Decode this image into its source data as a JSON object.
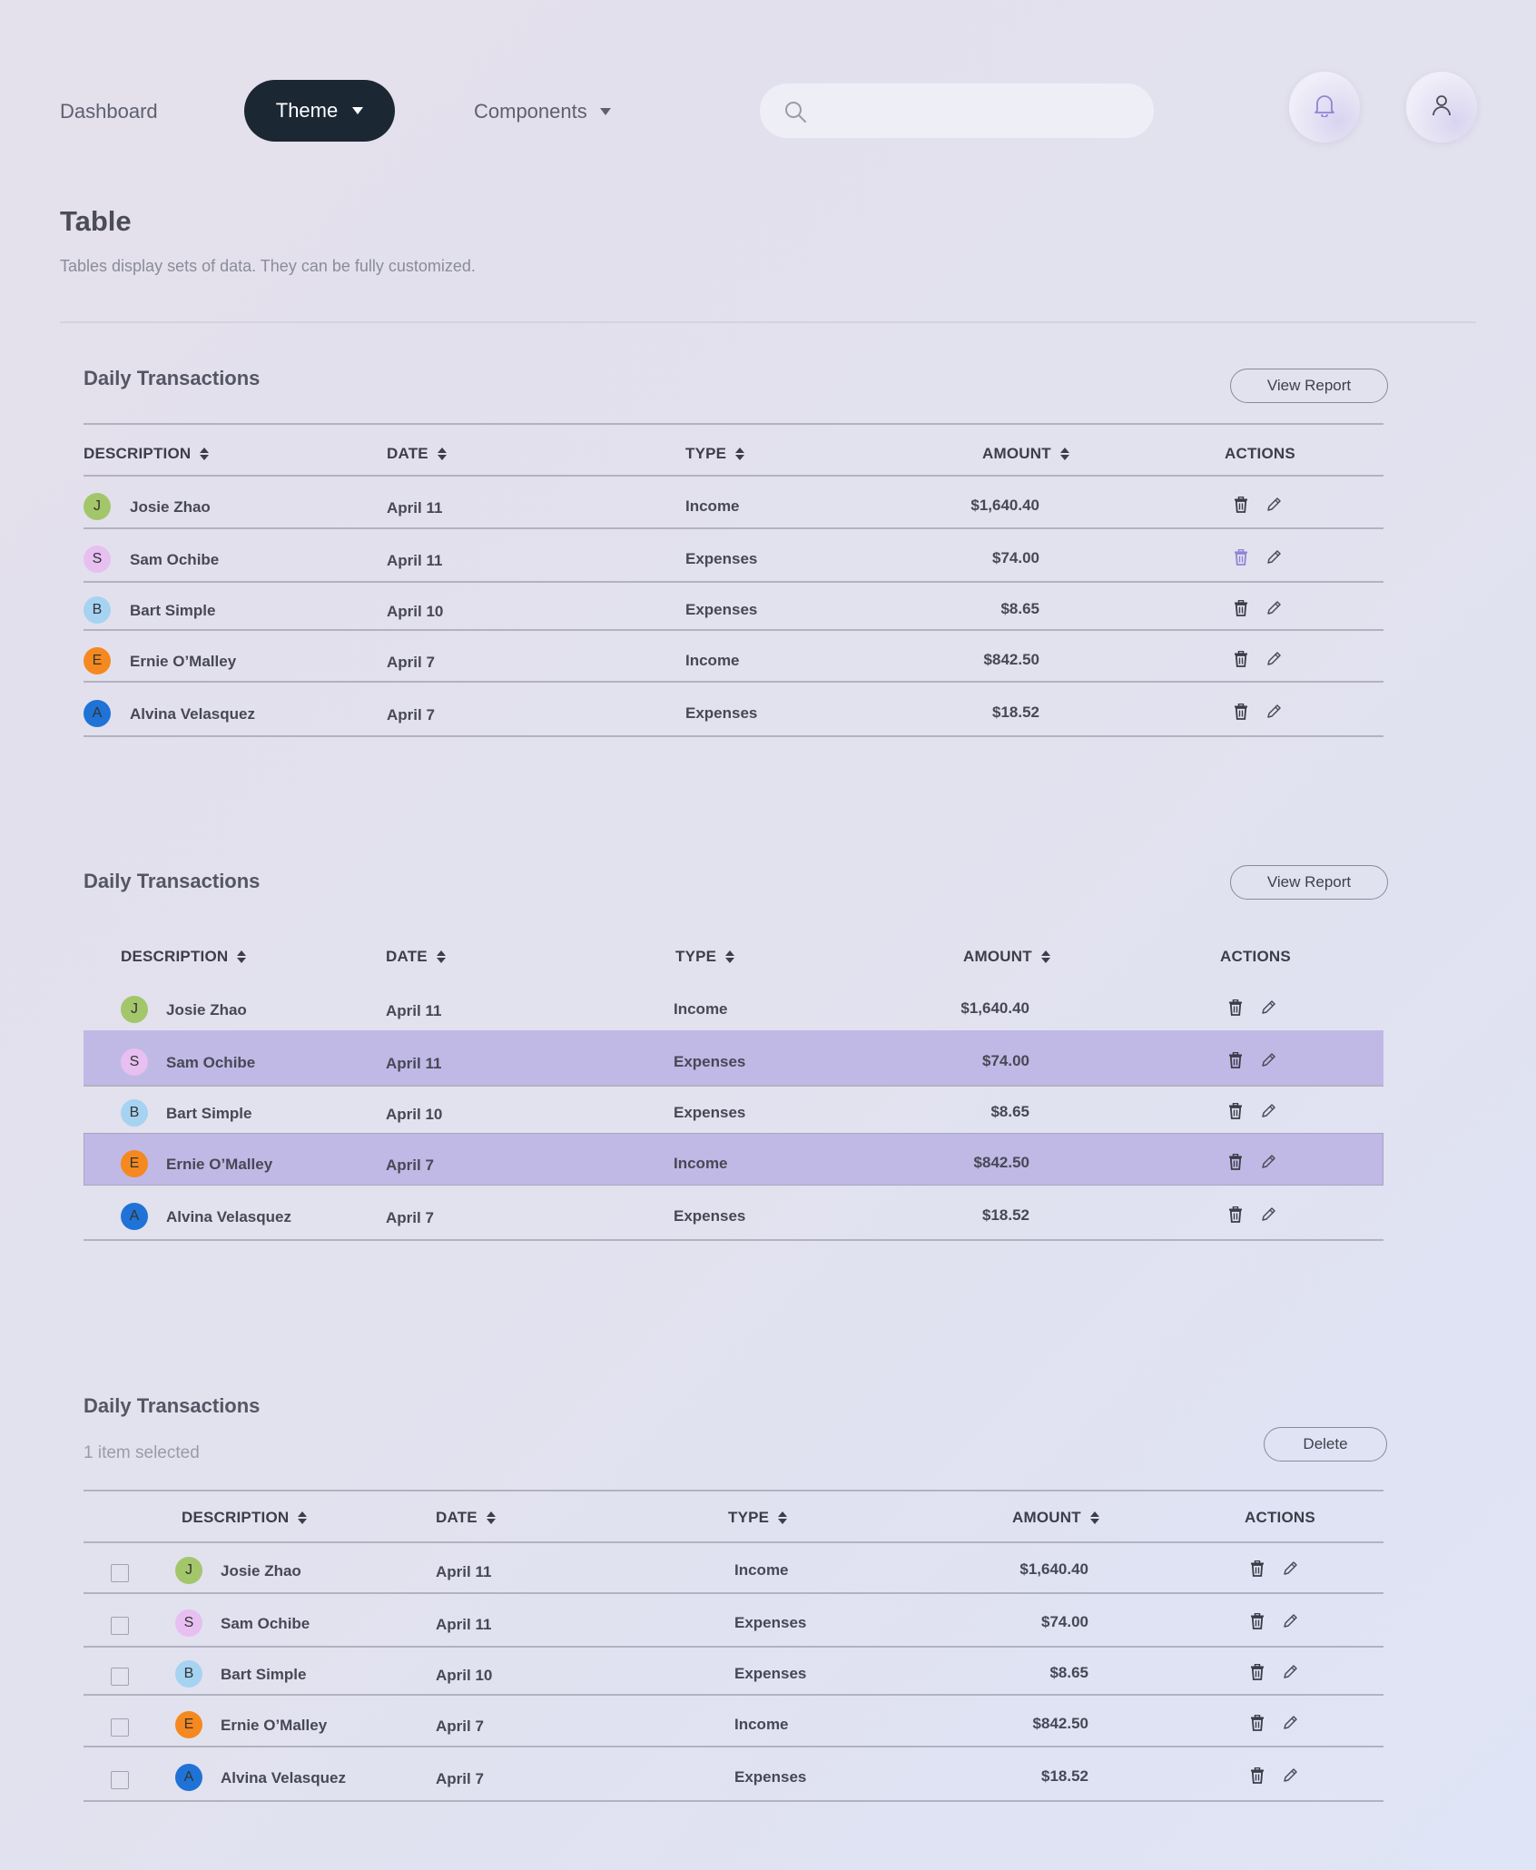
{
  "nav": {
    "dashboard": "Dashboard",
    "theme": "Theme",
    "components": "Components",
    "search_placeholder": ""
  },
  "page": {
    "title": "Table",
    "subtitle": "Tables display sets of data. They can be fully customized."
  },
  "tables": [
    {
      "title": "Daily Transactions",
      "button": "View Report",
      "columns": [
        "DESCRIPTION",
        "DATE",
        "TYPE",
        "AMOUNT",
        "ACTIONS"
      ]
    },
    {
      "title": "Daily Transactions",
      "button": "View Report",
      "columns": [
        "DESCRIPTION",
        "DATE",
        "TYPE",
        "AMOUNT",
        "ACTIONS"
      ]
    },
    {
      "title": "Daily Transactions",
      "selected_text": "1 item selected",
      "button": "Delete",
      "columns": [
        "DESCRIPTION",
        "DATE",
        "TYPE",
        "AMOUNT",
        "ACTIONS"
      ]
    }
  ],
  "rows": [
    {
      "initial": "J",
      "name": "Josie Zhao",
      "date": "April 11",
      "type": "Income",
      "amount": "$1,640.40",
      "avatar_color": "#a3c66b"
    },
    {
      "initial": "S",
      "name": "Sam Ochibe",
      "date": "April 11",
      "type": "Expenses",
      "amount": "$74.00",
      "avatar_color": "#e7bff0"
    },
    {
      "initial": "B",
      "name": "Bart Simple",
      "date": "April 10",
      "type": "Expenses",
      "amount": "$8.65",
      "avatar_color": "#a6d3f2"
    },
    {
      "initial": "E",
      "name": "Ernie O’Malley",
      "date": "April 7",
      "type": "Income",
      "amount": "$842.50",
      "avatar_color": "#f5891f"
    },
    {
      "initial": "A",
      "name": "Alvina Velasquez",
      "date": "April 7",
      "type": "Expenses",
      "amount": "$18.52",
      "avatar_color": "#1f73d6"
    }
  ],
  "colors": {
    "theme_button": "#1c2734",
    "highlight_row": "#c0b9e5",
    "trash_active": "#8e86d4"
  },
  "icons": [
    "search-icon",
    "bell-icon",
    "user-icon",
    "trash-icon",
    "pencil-icon",
    "sort-icon",
    "chevron-down-icon"
  ]
}
